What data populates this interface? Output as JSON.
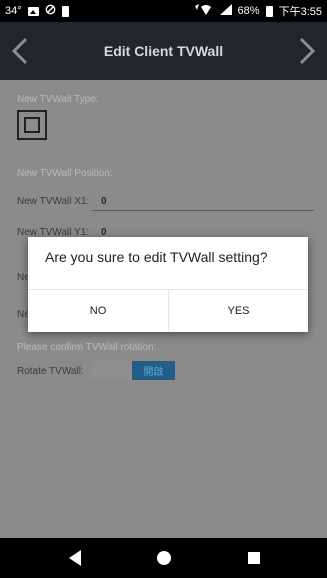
{
  "status_bar": {
    "temperature": "34°",
    "battery_percent": "68%",
    "time": "下午3:55"
  },
  "header": {
    "title": "Edit Client TVWall",
    "back_icon": "chevron-left-icon",
    "forward_icon": "chevron-right-icon"
  },
  "form": {
    "type_label": "New TVWall Type:",
    "type_icon": "tvwall-single-screen-icon",
    "position_label": "New TVWall Position:",
    "x1_label": "New TVWall X1:",
    "x1_value": "0",
    "y1_label": "New TVWall Y1:",
    "y1_value": "0",
    "row3_label_fragment": "Ne",
    "row4_label_fragment": "Ne",
    "rotation_confirm_label": "Please confirm TVWall rotation:",
    "rotate_label": "Rotate TVWall:",
    "rotate_toggle_text": "開啟"
  },
  "dialog": {
    "message": "Are you sure to edit TVWall setting?",
    "no_label": "NO",
    "yes_label": "YES"
  },
  "colors": {
    "header_bg": "#22262b",
    "overlay_bg": "#8b8b8b",
    "toggle_accent": "#235e86"
  }
}
